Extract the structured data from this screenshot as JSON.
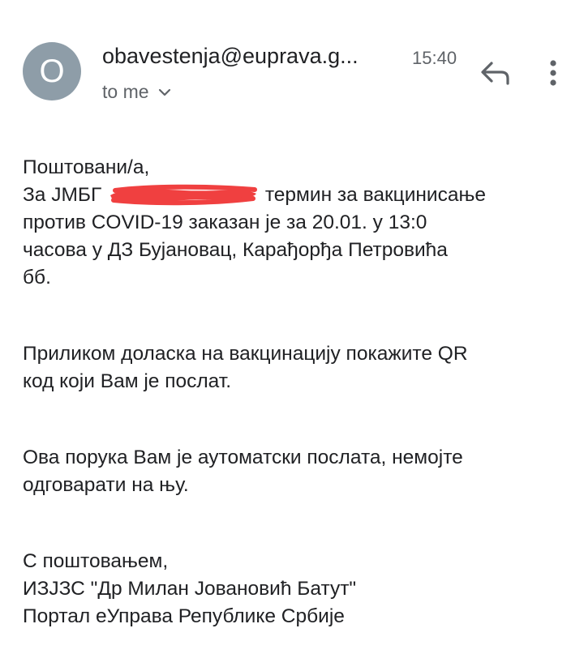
{
  "header": {
    "avatar_letter": "O",
    "sender": "obavestenja@euprava.g...",
    "time": "15:40",
    "recipient": "to me",
    "reply_icon": "reply-icon",
    "more_icon": "more-vert-icon"
  },
  "body": {
    "p1": {
      "line1": "Поштовани/а,",
      "line2_prefix": "За ЈМБГ",
      "line2_suffix": "термин за вакцинисање",
      "line3": "против COVID-19 заказан је за 20.01. у 13:0",
      "line4": "часова у ДЗ Бујановац, Карађорђа Петровића",
      "line5": "бб."
    },
    "p2": {
      "line1": "Приликом доласка на вакцинацију покажите QR",
      "line2": "код који Вам је послат."
    },
    "p3": {
      "line1": "Ова порука Вам је аутоматски послата, немојте",
      "line2": "одговарати на њу."
    },
    "p4": {
      "line1": "С поштовањем,",
      "line2": "ИЗЈЗС \"Др Милан Јовановић Батут\"",
      "line3": "Портал еУправа Републике Србије"
    }
  },
  "colors": {
    "avatar_bg": "#8e9da8",
    "text": "#202124",
    "secondary_text": "#5f6368",
    "redaction": "#f04040"
  }
}
